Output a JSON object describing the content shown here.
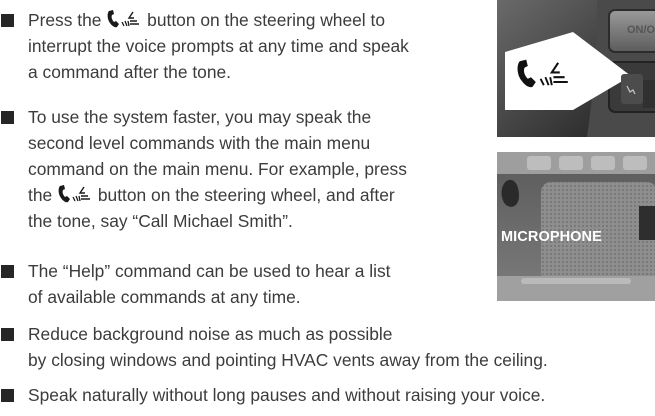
{
  "bullets": [
    {
      "lines": [
        {
          "before": "Press the",
          "after": "button on the steering wheel to"
        },
        {
          "text": "interrupt the voice prompts at any time and speak"
        },
        {
          "text": "a command after the tone."
        }
      ]
    },
    {
      "lines": [
        {
          "text": "To use the system faster, you may speak the"
        },
        {
          "text": "second level commands with the main menu"
        },
        {
          "text": "command on the main menu. For example, press"
        },
        {
          "before": "the",
          "after": "button on the steering wheel, and after"
        },
        {
          "text": "the tone, say “Call Michael Smith”."
        }
      ]
    },
    {
      "lines": [
        {
          "text": "The “Help” command can be used to hear a list"
        },
        {
          "text": "of available commands at any time."
        }
      ]
    },
    {
      "lines": [
        {
          "text": "Reduce background noise as much as possible"
        },
        {
          "text": "by closing windows and pointing HVAC vents away from the ceiling."
        }
      ]
    },
    {
      "lines": [
        {
          "text": "Speak naturally without long pauses and without raising your voice."
        }
      ]
    }
  ],
  "images": {
    "top": {
      "button_label": "ON/O",
      "icon": "phone-voice-icon"
    },
    "bottom": {
      "label": "MICROPHONE"
    }
  }
}
